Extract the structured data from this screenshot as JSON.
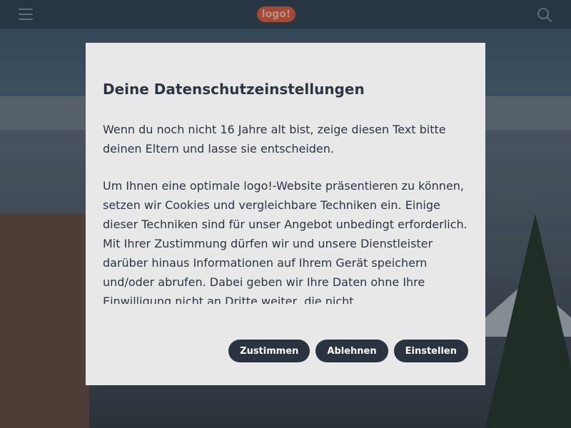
{
  "header": {
    "logo_text": "logo!",
    "menu_icon": "hamburger-icon",
    "search_icon": "search-icon"
  },
  "consent": {
    "title": "Deine Datenschutzeinstellungen",
    "paragraph_1": "Wenn du noch nicht 16 Jahre alt bist, zeige diesen Text bitte deinen Eltern und lasse sie entscheiden.",
    "paragraph_2": "Um Ihnen eine optimale logo!-Website präsentieren zu können, setzen wir Cookies und vergleichbare Techniken ein. Einige dieser Techniken sind für unser Angebot unbedingt erforderlich. Mit Ihrer Zustimmung dürfen wir und unsere Dienstleister darüber hinaus Informationen auf Ihrem Gerät speichern und/oder abrufen. Dabei geben wir Ihre Daten ohne Ihre Einwilligung nicht an Dritte weiter, die nicht",
    "buttons": {
      "accept": "Zustimmen",
      "reject": "Ablehnen",
      "settings": "Einstellen"
    }
  },
  "colors": {
    "header_bg": "#2e3f4c",
    "dialog_bg": "#e8e8e8",
    "button_bg": "#2b3340",
    "logo_bg": "#d25a3a"
  }
}
